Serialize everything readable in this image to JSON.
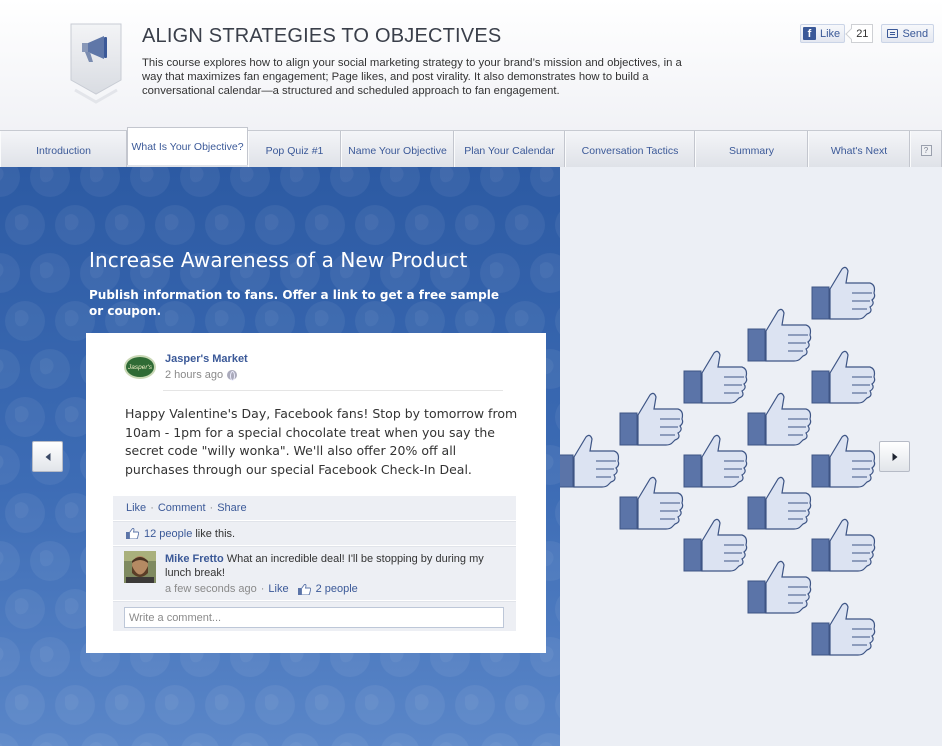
{
  "header": {
    "title": "ALIGN STRATEGIES TO OBJECTIVES",
    "description": "This course explores how to align your social marketing strategy to your brand’s mission and objectives, in a way that maximizes fan engagement; Page likes, and post virality. It also demonstrates how to build a conversational calendar—a structured and scheduled approach to fan engagement.",
    "like_label": "Like",
    "like_count": "21",
    "send_label": "Send"
  },
  "tabs": [
    {
      "label": "Introduction"
    },
    {
      "label": "What Is Your Objective?",
      "active": true
    },
    {
      "label": "Pop Quiz #1"
    },
    {
      "label": "Name Your Objective"
    },
    {
      "label": "Plan Your Calendar"
    },
    {
      "label": "Conversation Tactics"
    },
    {
      "label": "Summary"
    },
    {
      "label": "What's Next"
    },
    {
      "label": "?"
    }
  ],
  "slide": {
    "title": "Increase Awareness of a New Product",
    "subtitle": "Publish information to fans. Offer a link to get a free sample or coupon."
  },
  "post": {
    "avatar_text": "Jasper's",
    "page_name": "Jasper's Market",
    "time": "2 hours ago",
    "text": "Happy Valentine's Day, Facebook fans! Stop by tomorrow from 10am - 1pm for a special chocolate treat when you say the secret code \"willy wonka\". We'll also offer 20% off all purchases through our special Facebook Check-In Deal.",
    "actions": {
      "like": "Like",
      "comment": "Comment",
      "share": "Share",
      "sep": "·"
    },
    "likes_count": "12 people",
    "likes_suffix": "like this.",
    "comment": {
      "author": "Mike Fretto",
      "text": "What an incredible deal! I'll be stopping by during my lunch break!",
      "time": "a few seconds ago",
      "sep": "·",
      "like": "Like",
      "likes": "2 people"
    },
    "write_placeholder": "Write a comment..."
  },
  "colors": {
    "fb_blue": "#3b5998",
    "panel_blue": "#2c5aa3",
    "thumb_fill": "#dce3f2"
  },
  "icons": {
    "course": "megaphone-icon",
    "prev": "arrow-left-icon",
    "next": "arrow-right-icon",
    "like": "thumbs-up-icon"
  }
}
